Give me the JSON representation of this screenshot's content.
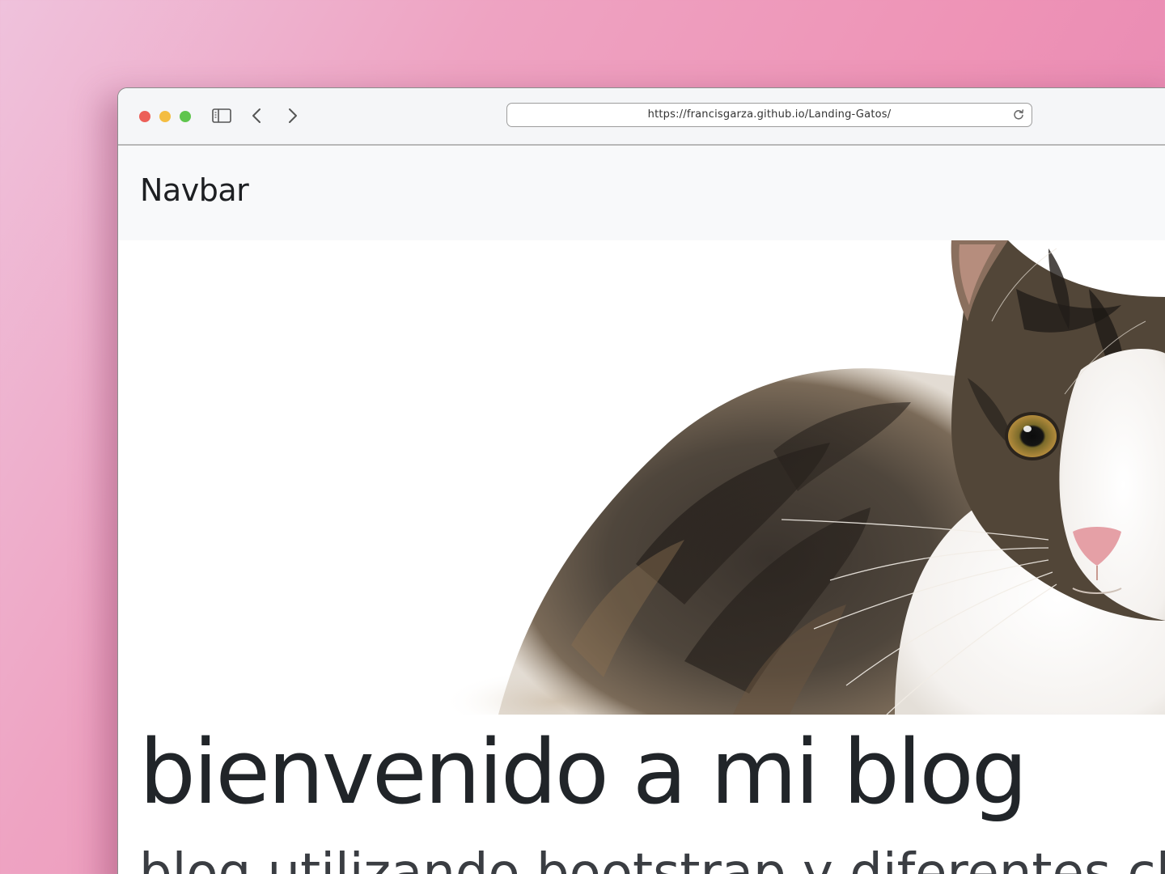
{
  "browser": {
    "url": "https://francisgarza.github.io/Landing-Gatos/",
    "controls": {
      "close_color": "#ec5f58",
      "minimize_color": "#f4bd41",
      "maximize_color": "#5fc54d"
    },
    "icons": [
      "sidebar-icon",
      "back-arrow-icon",
      "forward-arrow-icon",
      "reload-icon"
    ]
  },
  "navbar": {
    "brand": "Navbar"
  },
  "hero": {
    "image": "cat-photo"
  },
  "content": {
    "heading": "bienvenido a mi blog",
    "lead": "blog utilizando bootstrap y diferentes cl"
  }
}
